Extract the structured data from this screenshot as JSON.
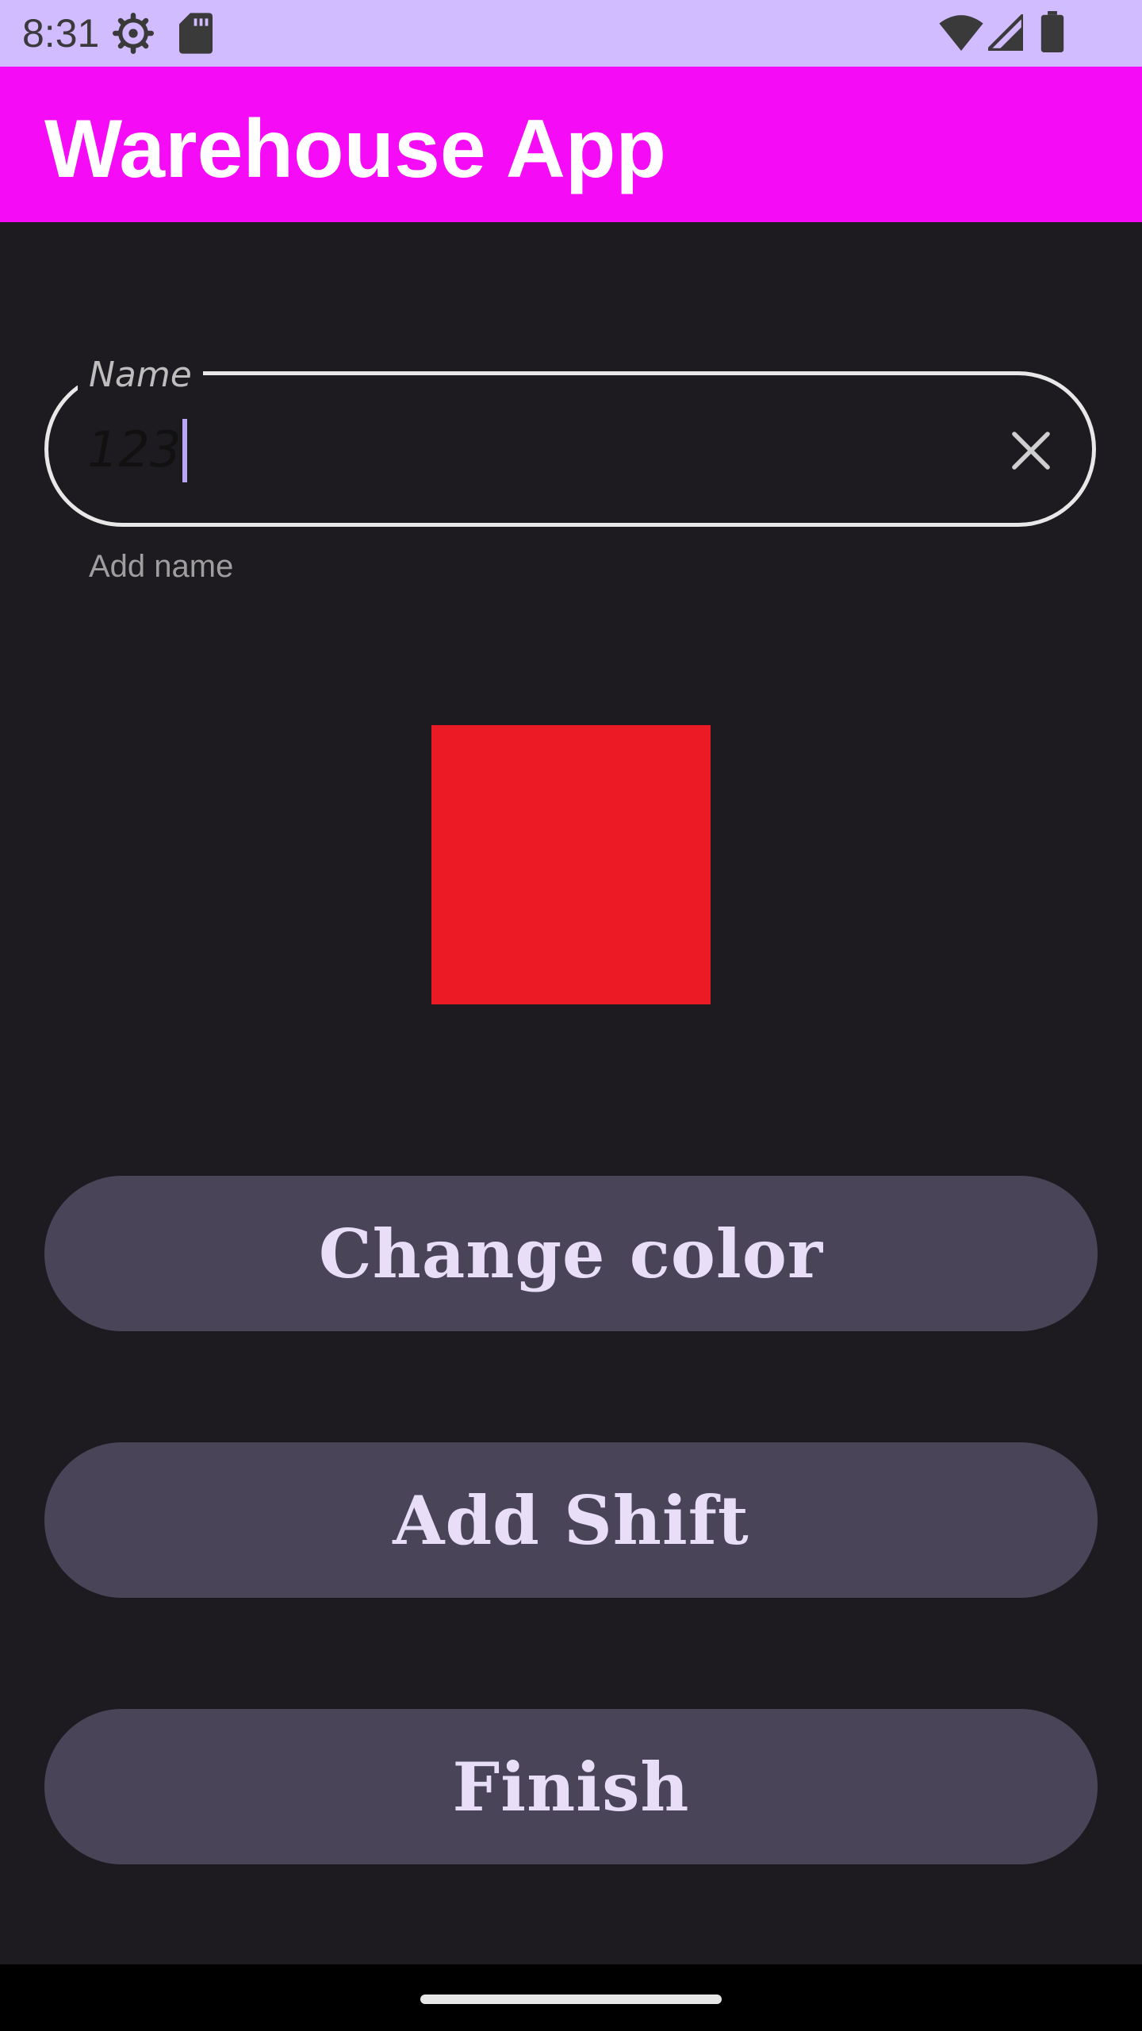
{
  "status_bar": {
    "time": "8:31",
    "icons_left": [
      "settings-gear-icon",
      "sd-card-icon"
    ],
    "icons_right": [
      "wifi-icon",
      "cellular-signal-icon",
      "battery-icon"
    ]
  },
  "app_bar": {
    "title": "Warehouse App",
    "color": "#f50bf5"
  },
  "name_field": {
    "label": "Name",
    "value": "123",
    "supporting_text": "Add name",
    "trailing_icon": "clear-icon"
  },
  "color_swatch": {
    "color": "#ec1a24"
  },
  "buttons": {
    "change_color": "Change color",
    "add_shift": "Add Shift",
    "finish": "Finish"
  },
  "theme": {
    "background": "#1d1b20",
    "status_bar": "#d0bcff",
    "button_background": "#4a4458",
    "button_text": "#e8def8"
  }
}
